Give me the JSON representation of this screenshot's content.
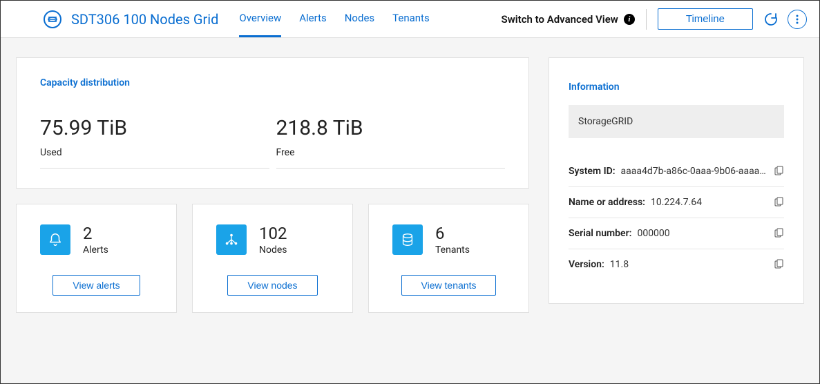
{
  "header": {
    "title": "SDT306 100 Nodes Grid",
    "tabs": [
      "Overview",
      "Alerts",
      "Nodes",
      "Tenants"
    ],
    "active_tab": 0,
    "advanced_view_label": "Switch to Advanced View",
    "timeline_label": "Timeline"
  },
  "capacity": {
    "title": "Capacity distribution",
    "used_value": "75.99 TiB",
    "used_label": "Used",
    "free_value": "218.8 TiB",
    "free_label": "Free"
  },
  "stats": {
    "alerts": {
      "value": "2",
      "label": "Alerts",
      "button": "View alerts"
    },
    "nodes": {
      "value": "102",
      "label": "Nodes",
      "button": "View nodes"
    },
    "tenants": {
      "value": "6",
      "label": "Tenants",
      "button": "View tenants"
    }
  },
  "info": {
    "title": "Information",
    "product": "StorageGRID",
    "rows": [
      {
        "key": "System ID:",
        "value": "aaaa4d7b-a86c-0aaa-9b06-aaaa6c4bff…"
      },
      {
        "key": "Name or address:",
        "value": "10.224.7.64"
      },
      {
        "key": "Serial number:",
        "value": "000000"
      },
      {
        "key": "Version:",
        "value": "11.8"
      }
    ]
  }
}
